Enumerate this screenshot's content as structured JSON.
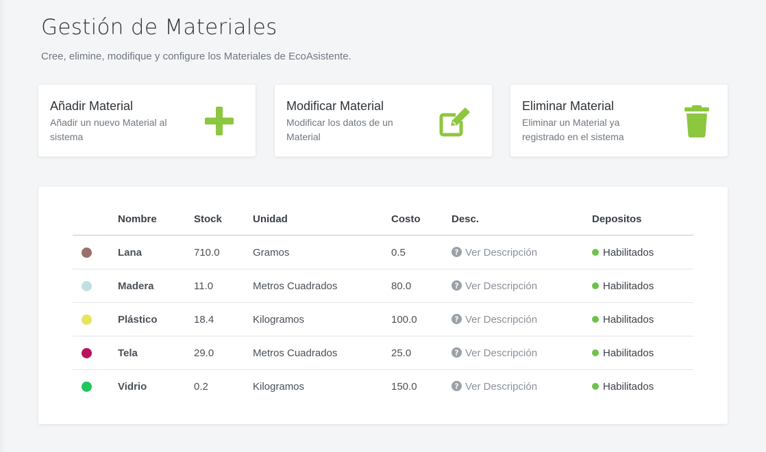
{
  "header": {
    "title": "Gestión de Materiales",
    "subtitle": "Cree, elimine, modifique y configure los Materiales de EcoAsistente."
  },
  "accent_color": "#8dc63f",
  "actions": [
    {
      "title": "Añadir Material",
      "description": "Añadir un nuevo Material al sistema",
      "icon": "plus-icon"
    },
    {
      "title": "Modificar Material",
      "description": "Modificar los datos de un Material",
      "icon": "edit-icon"
    },
    {
      "title": "Eliminar Material",
      "description": "Eliminar un Material ya registrado en el sistema",
      "icon": "trash-icon"
    }
  ],
  "table": {
    "headers": {
      "name": "Nombre",
      "stock": "Stock",
      "unit": "Unidad",
      "cost": "Costo",
      "desc": "Desc.",
      "deposits": "Depositos"
    },
    "rows": [
      {
        "color": "#9b6f6a",
        "name": "Lana",
        "stock": "710.0",
        "unit": "Gramos",
        "cost": "0.5",
        "desc_link": "Ver Descripción",
        "deposits": "Habilitados",
        "deposits_color": "#6cc24a"
      },
      {
        "color": "#bfe0e0",
        "name": "Madera",
        "stock": "11.0",
        "unit": "Metros Cuadrados",
        "cost": "80.0",
        "desc_link": "Ver Descripción",
        "deposits": "Habilitados",
        "deposits_color": "#6cc24a"
      },
      {
        "color": "#e8e35a",
        "name": "Plástico",
        "stock": "18.4",
        "unit": "Kilogramos",
        "cost": "100.0",
        "desc_link": "Ver Descripción",
        "deposits": "Habilitados",
        "deposits_color": "#6cc24a"
      },
      {
        "color": "#b8125a",
        "name": "Tela",
        "stock": "29.0",
        "unit": "Metros Cuadrados",
        "cost": "25.0",
        "desc_link": "Ver Descripción",
        "deposits": "Habilitados",
        "deposits_color": "#6cc24a"
      },
      {
        "color": "#22c55e",
        "name": "Vidrio",
        "stock": "0.2",
        "unit": "Kilogramos",
        "cost": "150.0",
        "desc_link": "Ver Descripción",
        "deposits": "Habilitados",
        "deposits_color": "#6cc24a"
      }
    ]
  }
}
